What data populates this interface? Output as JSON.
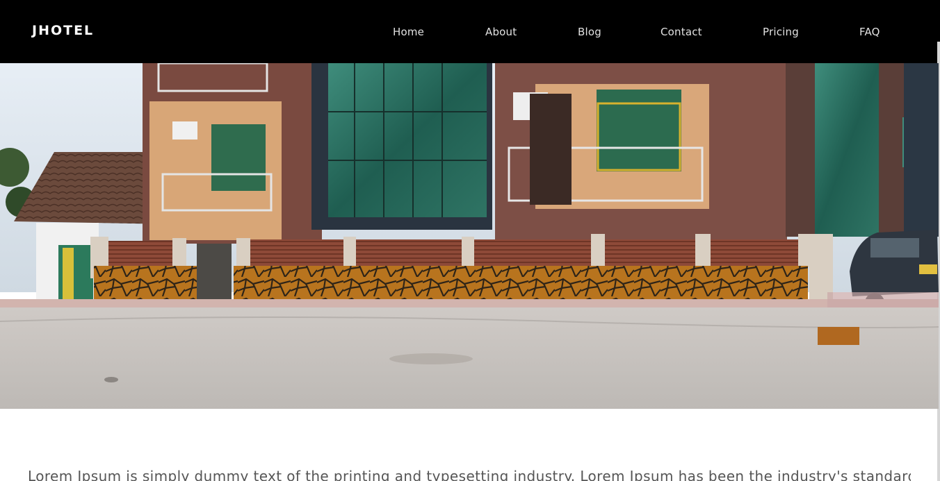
{
  "brand": {
    "name": "JHOTEL"
  },
  "nav": {
    "items": [
      {
        "label": "Home"
      },
      {
        "label": "About"
      },
      {
        "label": "Blog"
      },
      {
        "label": "Contact"
      },
      {
        "label": "Pricing"
      },
      {
        "label": "FAQ"
      }
    ]
  },
  "hero": {
    "image": "hotel-building-photo"
  },
  "content": {
    "intro_text": "Lorem Ipsum is simply dummy text of the printing and typesetting industry. Lorem Ipsum has been the industry's standard"
  },
  "colors": {
    "navbar_bg": "#000000",
    "brand_text": "#ffffff",
    "nav_text": "#e2e2e2",
    "body_bg": "#ffffff",
    "body_text": "#555555"
  }
}
